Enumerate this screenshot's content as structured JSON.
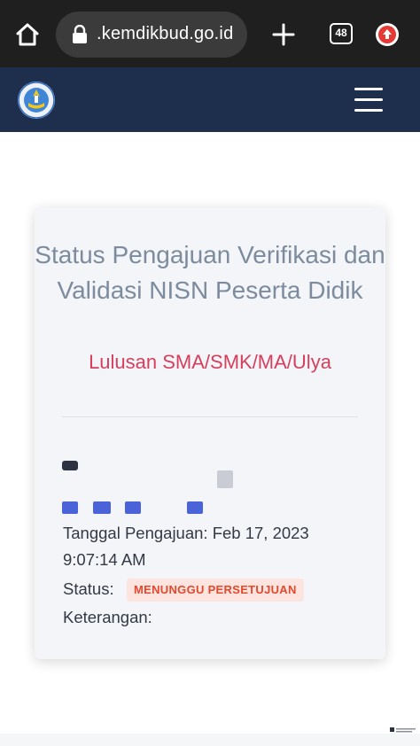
{
  "browser": {
    "url": ".kemdikbud.go.id",
    "tab_count": "48",
    "icons": [
      "home-icon",
      "lock-icon",
      "plus-icon",
      "tabs-icon",
      "update-arrow-icon"
    ],
    "update_color": "#e53935"
  },
  "site_header": {
    "background": "#1e2f4d",
    "icons": [
      "tut-wuri-handayani-logo",
      "hamburger-menu-icon"
    ]
  },
  "card": {
    "title": "Status Pengajuan Verifikasi dan Validasi NISN Peserta Didik",
    "subtitle": "Lulusan SMA/SMK/MA/Ulya",
    "submission_date_label": "Tanggal Pengajuan: Feb 17, 2023",
    "submission_time": "9:07:14 AM",
    "status_label": "Status:",
    "status_badge": "MENUNGGU PERSETUJUAN",
    "notes_label": "Keterangan:"
  },
  "colors": {
    "title": "#7c8c9e",
    "subtitle": "#d63f5e",
    "badge_bg": "#fde4df",
    "badge_text": "#e2492e"
  }
}
